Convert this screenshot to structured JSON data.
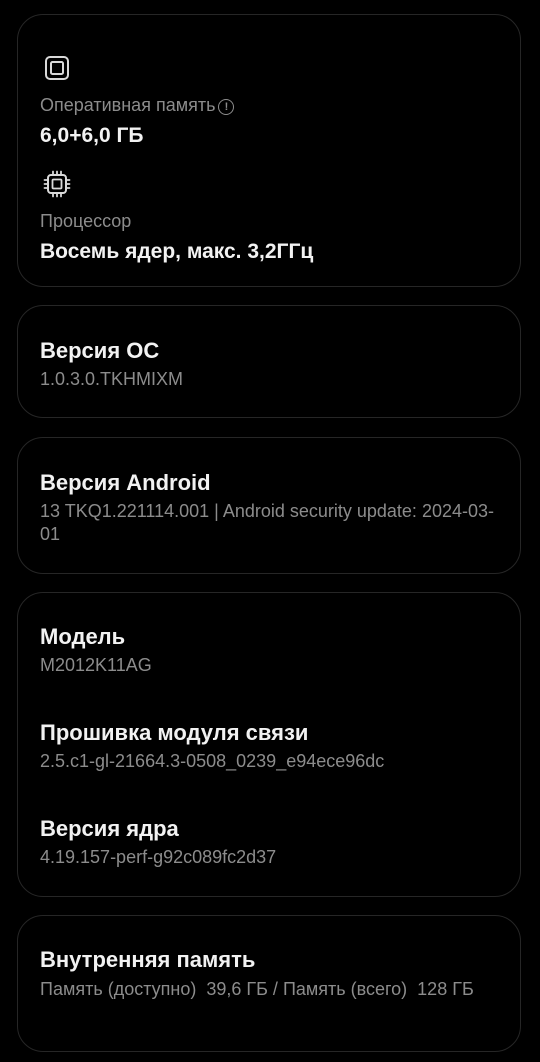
{
  "hardware": {
    "ram": {
      "icon": "memory-chip-icon",
      "label": "Оперативная память",
      "value": "6,0+6,0 ГБ"
    },
    "cpu": {
      "icon": "processor-chip-icon",
      "label": "Процессор",
      "value": "Восемь ядер, макс. 3,2ГГц"
    }
  },
  "os_version": {
    "title": "Версия ОС",
    "value": "1.0.3.0.TKHMIXM"
  },
  "android_version": {
    "title": "Версия Android",
    "value": "13 TKQ1.221114.001 | Android security update: 2024-03-01"
  },
  "device": {
    "model_title": "Модель",
    "model_value": "M2012K11AG",
    "baseband_title": "Прошивка модуля связи",
    "baseband_value": "2.5.c1-gl-21664.3-0508_0239_e94ece96dc",
    "kernel_title": "Версия ядра",
    "kernel_value": "4.19.157-perf-g92c089fc2d37"
  },
  "storage": {
    "title": "Внутренняя память",
    "value": "Память (доступно)  39,6 ГБ / Память (всего)  128 ГБ"
  },
  "colors": {
    "background": "#000000",
    "card_border": "#262626",
    "primary_text": "#f2f2f2",
    "secondary_text": "#8c8c8c"
  }
}
